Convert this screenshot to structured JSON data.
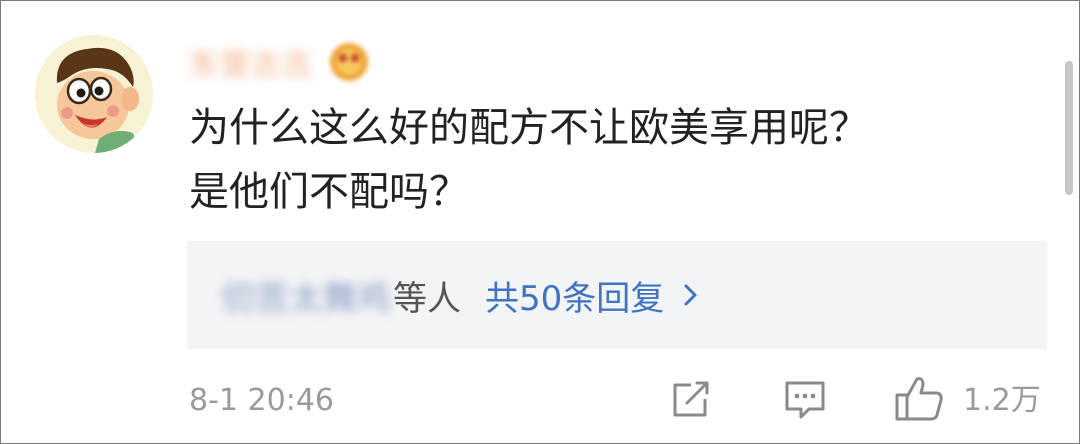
{
  "comment": {
    "username": "东营古古",
    "text_line1": "为什么这么好的配方不让欧美享用呢？",
    "text_line2": "是他们不配吗？",
    "timestamp": "8-1 20:46"
  },
  "replies": {
    "names": "仞苦太舞鸡",
    "suffix": "等人",
    "count_label": "共50条回复",
    "chevron": "›"
  },
  "actions": {
    "share_icon": "share-box-icon",
    "comment_icon": "comment-bubble-icon",
    "like_icon": "thumbs-up-icon",
    "like_count": "1.2万"
  },
  "colors": {
    "text": "#222222",
    "muted": "#9a9a9a",
    "link": "#3f74c2",
    "reply_bg": "#f3f4f6",
    "username": "#f0a070"
  }
}
